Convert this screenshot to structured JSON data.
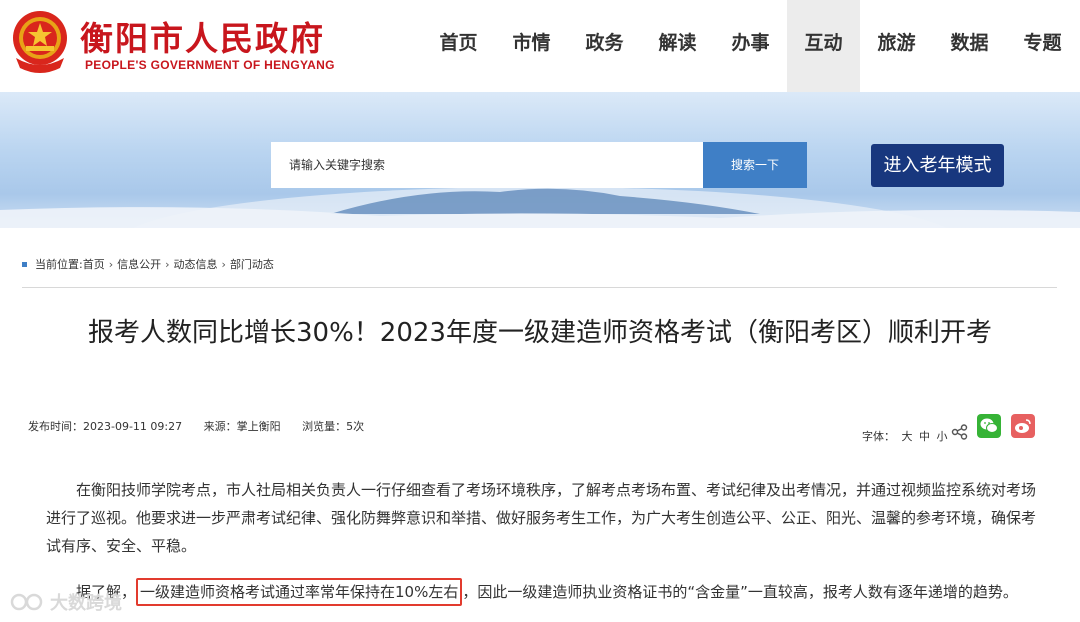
{
  "header": {
    "title": "衡阳市人民政府",
    "subtitle": "PEOPLE'S GOVERNMENT OF HENGYANG",
    "emblem_icon": "national-emblem-icon",
    "brand_color": "#c8161d"
  },
  "nav": {
    "items": [
      {
        "label": "首页"
      },
      {
        "label": "市情"
      },
      {
        "label": "政务"
      },
      {
        "label": "解读"
      },
      {
        "label": "办事"
      },
      {
        "label": "互动",
        "active": true
      },
      {
        "label": "旅游"
      },
      {
        "label": "数据"
      },
      {
        "label": "专题"
      }
    ]
  },
  "search": {
    "placeholder": "请输入关键字搜索",
    "button_label": "搜索一下"
  },
  "elder_mode_label": "进入老年模式",
  "breadcrumb": {
    "prefix": "当前位置:",
    "items": [
      "首页",
      "信息公开",
      "动态信息",
      "部门动态"
    ],
    "separator": "›"
  },
  "article": {
    "title": "报考人数同比增长30%！2023年度一级建造师资格考试（衡阳考区）顺利开考",
    "publish_time": "发布时间：2023-09-11 09:27",
    "source": "来源：掌上衡阳",
    "views": "浏览量：5次",
    "font_label": "字体：",
    "font_sizes": [
      "大",
      "中",
      "小"
    ],
    "paragraph1": "在衡阳技师学院考点，市人社局相关负责人一行仔细查看了考场环境秩序，了解考点考场布置、考试纪律及出考情况，并通过视频监控系统对考场进行了巡视。他要求进一步严肃考试纪律、强化防舞弊意识和举措、做好服务考生工作，为广大考生创造公平、公正、阳光、温馨的参考环境，确保考试有序、安全、平稳。",
    "paragraph2_lead": "据了解，",
    "paragraph2_highlight": "一级建造师资格考试通过率常年保持在10%左右",
    "paragraph2_rest": "，因此一级建造师执业资格证书的“含金量”一直较高，报考人数有逐年递增的趋势。"
  },
  "watermark": "大数跨境",
  "colors": {
    "search_button": "#3f7fc6",
    "elder_button": "#18377e",
    "highlight_border": "#e23b2e",
    "wechat": "#36b336",
    "weibo": "#e76060"
  }
}
